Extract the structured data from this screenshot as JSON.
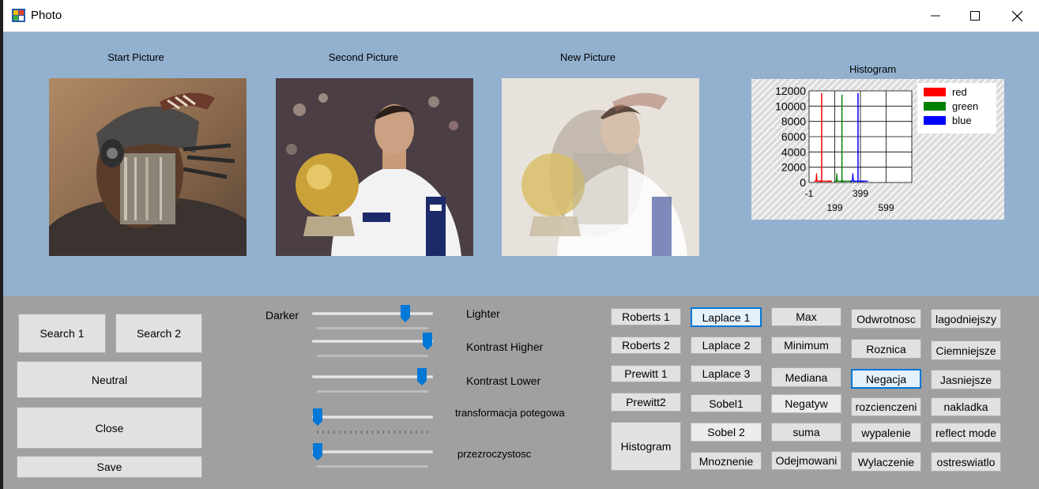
{
  "window": {
    "title": "Photo"
  },
  "pictures": {
    "start_label": "Start Picture",
    "second_label": "Second Picture",
    "new_label": "New Picture"
  },
  "histogram": {
    "title": "Histogram",
    "legend": [
      "red",
      "green",
      "blue"
    ],
    "colors": {
      "red": "#ff0000",
      "green": "#008000",
      "blue": "#0000ff"
    },
    "yticks": [
      "12000",
      "10000",
      "8000",
      "6000",
      "4000",
      "2000",
      "0"
    ],
    "xticks_row1": [
      "-1",
      "399"
    ],
    "xticks_row2": [
      "199",
      "599"
    ]
  },
  "chart_data": {
    "type": "line",
    "title": "Histogram",
    "ylim": [
      0,
      12000
    ],
    "xlim": [
      -1,
      799
    ],
    "series": [
      {
        "name": "red",
        "peak_x": 97,
        "peak_y": 11700
      },
      {
        "name": "green",
        "peak_x": 255,
        "peak_y": 11500
      },
      {
        "name": "blue",
        "peak_x": 380,
        "peak_y": 11700
      }
    ]
  },
  "left_buttons": {
    "search1": "Search 1",
    "search2": "Search 2",
    "neutral": "Neutral",
    "close": "Close",
    "save": "Save"
  },
  "sliders": {
    "darker": "Darker",
    "lighter": "Lighter",
    "kontrast_higher": "Kontrast Higher",
    "kontrast_lower": "Kontrast Lower",
    "transformacja": "transformacja potegowa",
    "przezroczystosc": "przezroczystosc",
    "values": {
      "brightness": 0.8,
      "kontrast_higher": 1.0,
      "kontrast_lower": 0.95,
      "transformacja": 0.0,
      "przezroczystosc": 0.0
    }
  },
  "filters": {
    "col1": [
      "Roberts 1",
      "Roberts 2",
      "Prewitt 1",
      "Prewitt2"
    ],
    "histogram_btn": "Histogram",
    "col2": [
      "Laplace 1",
      "Laplace 2",
      "Laplace 3",
      "Sobel1",
      "Sobel 2",
      "Mnoznenie"
    ],
    "col3": [
      "Max",
      "Minimum",
      "Mediana",
      "Negatyw",
      "suma",
      "Odejmowani"
    ],
    "col4": [
      "Odwrotnosc",
      "Roznica",
      "Negacja",
      "rozcienczeni",
      "wypalenie",
      "Wylaczenie"
    ],
    "col5": [
      "lagodniejszy",
      "Ciemniejsze",
      "Jasniejsze",
      "nakladka",
      "reflect mode",
      "ostreswiatlo"
    ]
  }
}
